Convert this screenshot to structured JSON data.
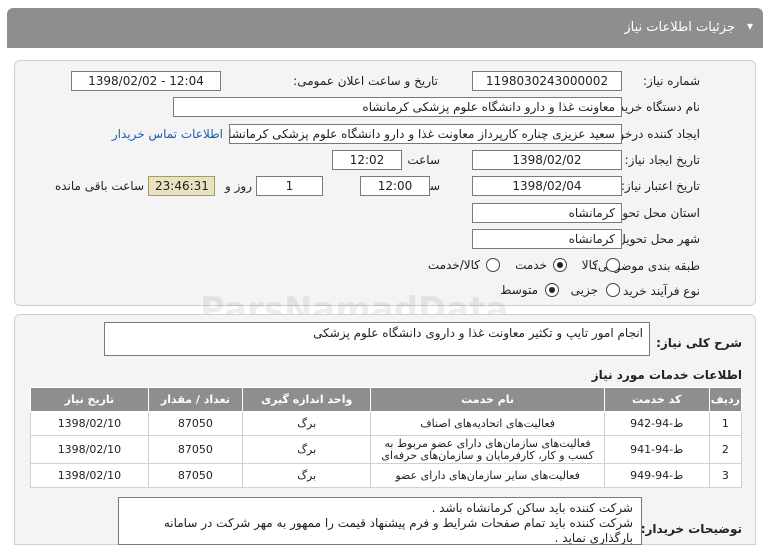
{
  "header": {
    "title": "جزئیات اطلاعات نیاز"
  },
  "form": {
    "need_number_label": "شماره نیاز:",
    "need_number": "1198030243000002",
    "announce_label": "تاریخ و ساعت اعلان عمومی:",
    "announce_value": "1398/02/02 - 12:04",
    "buyer_label": "نام دستگاه خریدار:",
    "buyer_value": "معاونت غذا و دارو دانشگاه علوم پزشکی کرمانشاه",
    "creator_label": "ایجاد کننده درخواست:",
    "creator_value": "سعید عزیزی چناره کارپرداز معاونت غذا و دارو دانشگاه علوم پزشکی کرمانشاه",
    "contact_link": "اطلاعات تماس خریدار",
    "created_date_label": "تاریخ ایجاد نیاز:",
    "created_date": "1398/02/02",
    "time_label": "ساعت",
    "created_time": "12:02",
    "valid_date_label": "تاریخ اعتبار نیاز:",
    "valid_date": "1398/02/04",
    "valid_time": "12:00",
    "days_value": "1",
    "days_label": "روز و",
    "remaining_value": "23:46:31",
    "remaining_label": "ساعت باقی مانده",
    "province_label": "استان محل تحویل:",
    "province_value": "کرمانشاه",
    "city_label": "شهر محل تحویل:",
    "city_value": "کرمانشاه",
    "category_label": "طبقه بندی موضوعی:",
    "category_options": [
      "کالا",
      "خدمت",
      "کالا/خدمت"
    ],
    "category_selected": "خدمت",
    "process_label": "نوع فرآیند خرید :",
    "process_options": [
      "جزیی",
      "متوسط"
    ],
    "process_selected": "متوسط"
  },
  "summary": {
    "label": "شرح کلی نیاز:",
    "value": "انجام امور تایپ و تکثیر معاونت غذا و داروی دانشگاه علوم پزشکی"
  },
  "services": {
    "title": "اطلاعات خدمات مورد نیاز",
    "columns": [
      "ردیف",
      "کد خدمت",
      "نام خدمت",
      "واحد اندازه گیری",
      "تعداد / مقدار",
      "تاریخ نیاز"
    ],
    "rows": [
      {
        "row": "1",
        "code": "ط-94-942",
        "name": "فعالیت‌های اتحادیه‌های اصناف",
        "unit": "برگ",
        "qty": "87050",
        "date": "1398/02/10"
      },
      {
        "row": "2",
        "code": "ط-94-941",
        "name": "فعالیت‌های سازمان‌های دارای عضو مربوط به کسب و کار، کارفرمایان و سازمان‌های حرفه‌ای",
        "unit": "برگ",
        "qty": "87050",
        "date": "1398/02/10"
      },
      {
        "row": "3",
        "code": "ط-94-949",
        "name": "فعالیت‌های سایر سازمان‌های دارای عضو",
        "unit": "برگ",
        "qty": "87050",
        "date": "1398/02/10"
      }
    ]
  },
  "notes": {
    "label": "توضیحات خریدار:",
    "lines": [
      "شرکت کننده باید ساکن کرمانشاه باشد .",
      "شرکت کننده باید تمام صفحات شرایط و فرم پیشنهاد قیمت را ممهور به مهر شرکت در سامانه بارگذاری نماید ."
    ]
  },
  "watermark": "ParsNamadData"
}
